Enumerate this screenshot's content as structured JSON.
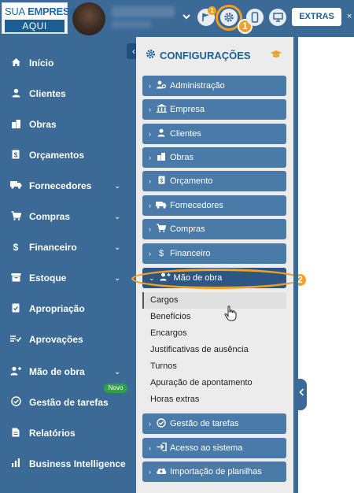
{
  "brand": {
    "line1_bold": "SUA",
    "line1_rest": "EMPRESA",
    "line2": "AQUI"
  },
  "header": {
    "notification_count": "1",
    "step1": "1",
    "extras_label": "EXTRAS",
    "close_glyph": "×"
  },
  "sidebar": {
    "items": [
      {
        "label": "Início",
        "icon": "home-icon",
        "glyph": "⌂"
      },
      {
        "label": "Clientes",
        "icon": "user-icon",
        "glyph": "●"
      },
      {
        "label": "Obras",
        "icon": "buildings-icon",
        "glyph": "▦"
      },
      {
        "label": "Orçamentos",
        "icon": "dollar-doc-icon",
        "glyph": "$"
      },
      {
        "label": "Fornecedores",
        "icon": "truck-icon",
        "glyph": "▬"
      },
      {
        "label": "Compras",
        "icon": "cart-icon",
        "glyph": "▾"
      },
      {
        "label": "Financeiro",
        "icon": "dollar-icon",
        "glyph": "$"
      },
      {
        "label": "Estoque",
        "icon": "box-icon",
        "glyph": "▤"
      },
      {
        "label": "Apropriação",
        "icon": "check-doc-icon",
        "glyph": "✓"
      },
      {
        "label": "Aprovações",
        "icon": "approve-list-icon",
        "glyph": "≡"
      },
      {
        "label": "Mão de obra",
        "icon": "workers-icon",
        "glyph": "✦"
      },
      {
        "label": "Gestão de tarefas",
        "icon": "check-circle-icon",
        "glyph": "✓"
      },
      {
        "label": "Relatórios",
        "icon": "report-icon",
        "glyph": "▤"
      },
      {
        "label": "Business Intelligence",
        "icon": "bar-chart-icon",
        "glyph": "▮"
      }
    ],
    "novo_badge": "Novo",
    "collapse_glyph": "‹",
    "chevron_glyph": "⌄"
  },
  "config": {
    "title": "CONFIGURAÇÕES",
    "menu": [
      {
        "label": "Administração",
        "icon": "admin-icon",
        "glyph": "⚙"
      },
      {
        "label": "Empresa",
        "icon": "bank-icon",
        "glyph": "▥"
      },
      {
        "label": "Clientes",
        "icon": "user-icon",
        "glyph": "●"
      },
      {
        "label": "Obras",
        "icon": "buildings-icon",
        "glyph": "▦"
      },
      {
        "label": "Orçamento",
        "icon": "dollar-doc-icon",
        "glyph": "$"
      },
      {
        "label": "Fornecedores",
        "icon": "truck-icon",
        "glyph": "▬"
      },
      {
        "label": "Compras",
        "icon": "cart-icon",
        "glyph": "▾"
      },
      {
        "label": "Financeiro",
        "icon": "dollar-icon",
        "glyph": "$"
      },
      {
        "label": "Mão de obra",
        "icon": "workers-icon",
        "glyph": "✦"
      }
    ],
    "step2": "2",
    "sub_items": [
      "Cargos",
      "Benefícios",
      "Encargos",
      "Justificativas de ausência",
      "Turnos",
      "Apuração de apontamento",
      "Horas extras"
    ],
    "menu_bottom": [
      {
        "label": "Gestão de tarefas",
        "icon": "check-circle-icon",
        "glyph": "✓"
      },
      {
        "label": "Acesso ao sistema",
        "icon": "login-icon",
        "glyph": "⇥"
      },
      {
        "label": "Importação de planilhas",
        "icon": "cloud-upload-icon",
        "glyph": "☁"
      }
    ]
  },
  "colors": {
    "sidebar": "#3b6a96",
    "accent": "#f0a028",
    "menu_button": "#4a7aa8",
    "active_button": "#2d5782"
  }
}
